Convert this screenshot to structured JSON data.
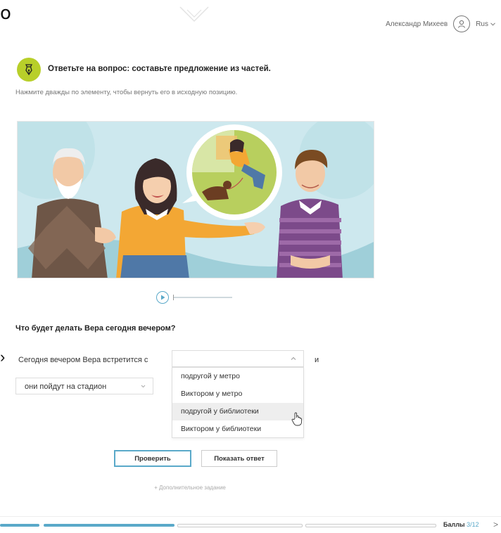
{
  "edge": {
    "left_char": "о",
    "arrow_char": "›"
  },
  "header": {
    "user_name": "Александр Михеев",
    "language": "Rus"
  },
  "task": {
    "instruction": "Ответьте на вопрос: составьте предложение из частей.",
    "hint": "Нажмите дважды по элементу, чтобы вернуть его в исходную позицию."
  },
  "question": {
    "text": "Что будет делать Вера сегодня вечером?",
    "sentence_start": "Сегодня вечером Вера встретится с",
    "conjunction": "и",
    "second_select_value": "они пойдут на стадион",
    "dropdown_options": [
      "подругой у метро",
      "Виктором у метро",
      "подругой у библиотеки",
      "Виктором у библиотеки"
    ],
    "hovered_option_index": 2
  },
  "buttons": {
    "check": "Проверить",
    "show_answer": "Показать ответ"
  },
  "extra_task": "+ Дополнительное задание",
  "footer": {
    "score_label": "Баллы",
    "score_value": "3/12"
  },
  "colors": {
    "accent": "#5aa9c9",
    "task_icon_bg": "#b8cf2a"
  }
}
